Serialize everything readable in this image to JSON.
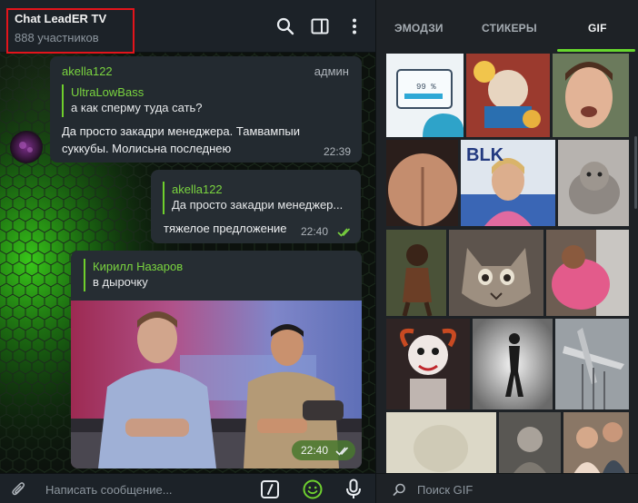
{
  "chat": {
    "title": "Chat LeadER TV",
    "members": "888 участников",
    "messages": [
      {
        "sender": "akella122",
        "role": "админ",
        "reply_name": "UltraLowBass",
        "reply_text": "а как сперму туда сать?",
        "text_lines": [
          "Да просто закадри менеджера. Тамвампыи",
          "суккубы. Молисьна последнею"
        ],
        "time": "22:39"
      },
      {
        "reply_name": "akella122",
        "reply_text": "Да просто закадри менеджер...",
        "text": "тяжелое предложение",
        "time": "22:40"
      },
      {
        "reply_name": "Кирилл Назаров",
        "reply_text": "в дырочку",
        "time": "22:40"
      }
    ],
    "composer_placeholder": "Написать сообщение...",
    "accent": "#6fcf2c"
  },
  "panel": {
    "tabs": [
      "ЭМОДЗИ",
      "СТИКЕРЫ",
      "GIF"
    ],
    "active_tab": "GIF",
    "gif_label_1": "99 %",
    "gif_label_2": "BLK",
    "search_placeholder": "Поиск GIF"
  },
  "icons": [
    "search-icon",
    "sidebar-toggle-icon",
    "more-vertical-icon",
    "paperclip-icon",
    "bot-command-icon",
    "emoji-icon",
    "microphone-icon",
    "read-checks-icon",
    "gif-search-icon"
  ]
}
